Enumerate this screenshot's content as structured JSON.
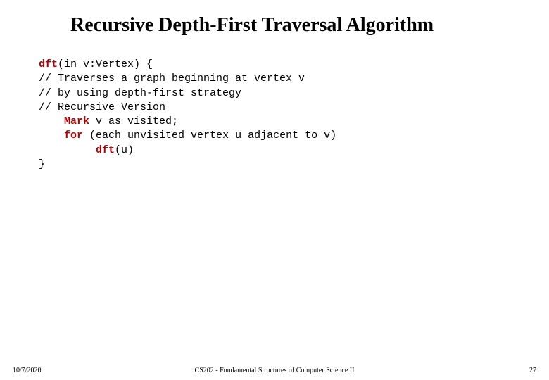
{
  "title": "Recursive Depth-First Traversal Algorithm",
  "code": {
    "l1_kw": "dft",
    "l1_rest": "(in v:Vertex) {",
    "l2": "// Traverses a graph beginning at vertex v",
    "l3": "// by using depth-first strategy",
    "l4": "// Recursive Version",
    "l5_indent": "    ",
    "l5_kw": "Mark",
    "l5_rest": " v as visited;",
    "l6_indent": "    ",
    "l6_kw": "for",
    "l6_rest": " (each unvisited vertex u adjacent to v)",
    "l7_indent": "         ",
    "l7_kw": "dft",
    "l7_rest": "(u)",
    "l8": "}"
  },
  "footer": {
    "date": "10/7/2020",
    "center": "CS202 - Fundamental Structures of Computer Science II",
    "page": "27"
  }
}
